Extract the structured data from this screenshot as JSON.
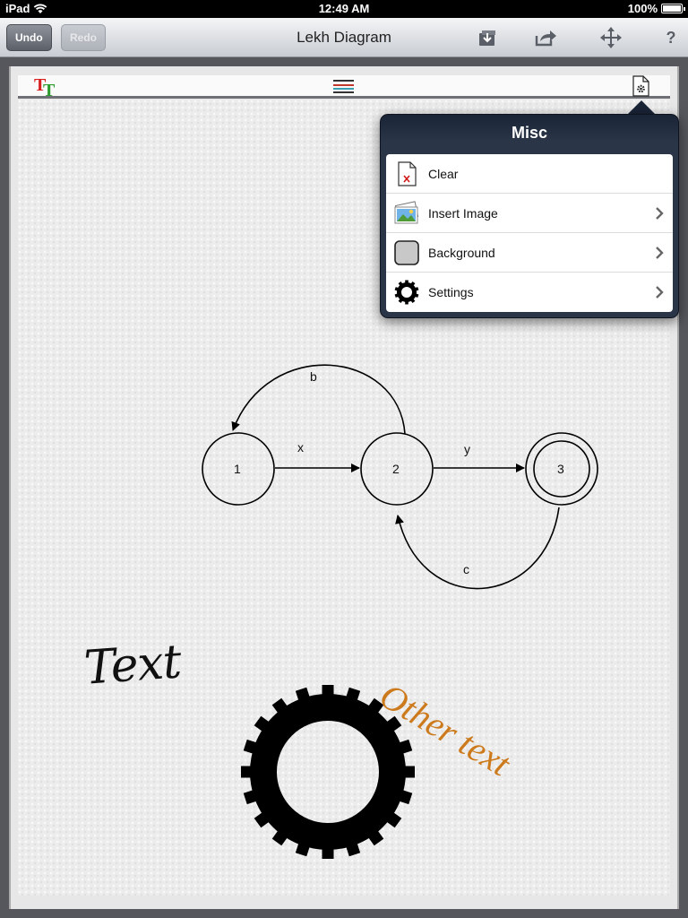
{
  "status_bar": {
    "device": "iPad",
    "time": "12:49 AM",
    "battery": "100%"
  },
  "toolbar": {
    "undo_label": "Undo",
    "redo_label": "Redo",
    "title": "Lekh Diagram",
    "icons": [
      "import-icon",
      "share-icon",
      "move-icon",
      "help-icon"
    ],
    "help_label": "?"
  },
  "sheet_toolbar": {
    "icons": [
      "text-style-icon",
      "line-style-icon",
      "misc-settings-icon"
    ],
    "text_style_letters": [
      "T",
      "T"
    ]
  },
  "popover": {
    "title": "Misc",
    "items": [
      {
        "label": "Clear",
        "icon": "clear-document-icon",
        "has_chevron": false
      },
      {
        "label": "Insert Image",
        "icon": "insert-image-icon",
        "has_chevron": true
      },
      {
        "label": "Background",
        "icon": "background-swatch-icon",
        "has_chevron": true
      },
      {
        "label": "Settings",
        "icon": "gear-icon",
        "has_chevron": true
      }
    ]
  },
  "diagram": {
    "nodes": [
      {
        "id": "1",
        "label": "1",
        "accepting": false
      },
      {
        "id": "2",
        "label": "2",
        "accepting": false
      },
      {
        "id": "3",
        "label": "3",
        "accepting": true
      }
    ],
    "edges": [
      {
        "from": "1",
        "to": "2",
        "label": "x"
      },
      {
        "from": "2",
        "to": "3",
        "label": "y"
      },
      {
        "from": "2",
        "to": "1",
        "label": "b"
      },
      {
        "from": "3",
        "to": "2",
        "label": "c"
      }
    ],
    "texts": [
      {
        "label": "Text",
        "color": "#111111"
      },
      {
        "label": "Other text",
        "color": "#cc7a1c"
      }
    ],
    "shapes": [
      "gear-shape"
    ]
  },
  "colors": {
    "toolbar_top": "#f4f5f7",
    "popover": "#2b3548",
    "accent_orange": "#cc7a1c"
  }
}
